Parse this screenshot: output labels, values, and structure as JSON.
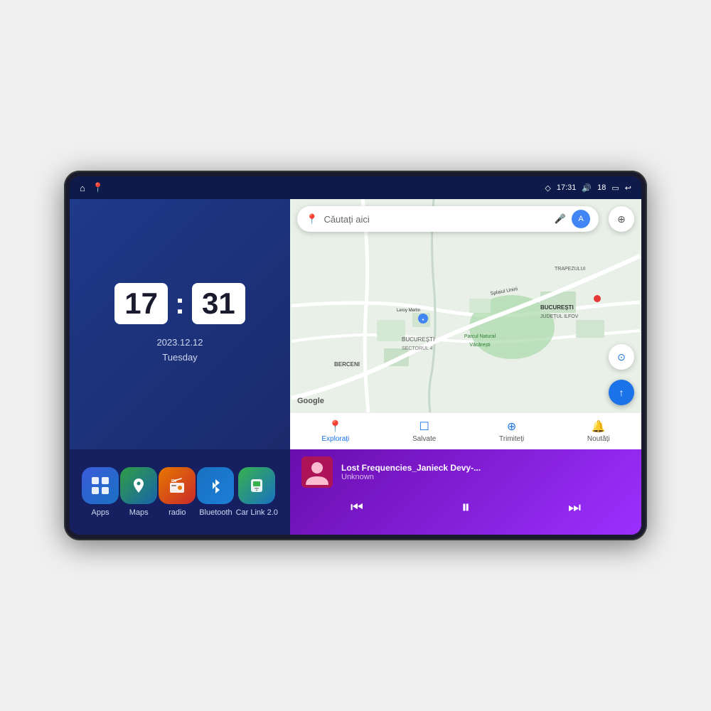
{
  "device": {
    "status_bar": {
      "time": "17:31",
      "signal_strength": "18",
      "battery_icon": "🔋",
      "back_label": "←",
      "home_icon": "⌂",
      "map_icon": "📍"
    }
  },
  "clock": {
    "hours": "17",
    "minutes": "31",
    "date": "2023.12.12",
    "day": "Tuesday"
  },
  "apps": [
    {
      "id": "apps",
      "label": "Apps",
      "icon": "⊞",
      "class": "icon-apps"
    },
    {
      "id": "maps",
      "label": "Maps",
      "icon": "📍",
      "class": "icon-maps"
    },
    {
      "id": "radio",
      "label": "radio",
      "icon": "📻",
      "class": "icon-radio"
    },
    {
      "id": "bluetooth",
      "label": "Bluetooth",
      "icon": "🔵",
      "class": "icon-bluetooth"
    },
    {
      "id": "carlink",
      "label": "Car Link 2.0",
      "icon": "📱",
      "class": "icon-carlink"
    }
  ],
  "map": {
    "search_placeholder": "Căutați aici",
    "google_logo": "Google",
    "nav_items": [
      {
        "id": "explore",
        "icon": "📍",
        "label": "Explorați",
        "active": true
      },
      {
        "id": "saved",
        "icon": "☐",
        "label": "Salvate",
        "active": false
      },
      {
        "id": "share",
        "icon": "⊕",
        "label": "Trimiteți",
        "active": false
      },
      {
        "id": "news",
        "icon": "🔔",
        "label": "Noutăți",
        "active": false
      }
    ],
    "location": "BUCUREȘTI",
    "location2": "JUDEȚUL ILFOV",
    "location3": "TRAPEZULUI",
    "location4": "BERCENI",
    "park": "Parcul Natural Văcărești",
    "store": "Leroy Merlin",
    "district": "BUCUREȘTI SECTORUL 4"
  },
  "music": {
    "title": "Lost Frequencies_Janieck Devy-...",
    "artist": "Unknown",
    "prev_label": "⏮",
    "play_label": "⏸",
    "next_label": "⏭"
  }
}
